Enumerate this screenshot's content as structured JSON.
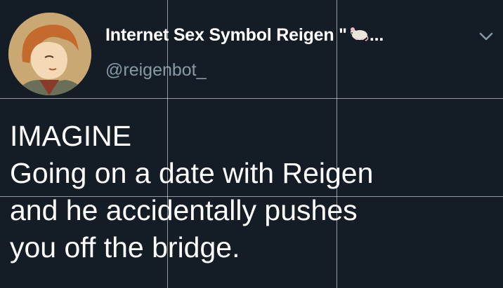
{
  "tweet": {
    "display_name": "Internet Sex Symbol Reigen \"",
    "name_truncation": "...",
    "handle": "@reigenbot_",
    "name_emoji_icon": "rat-emoji-icon",
    "menu_icon": "chevron-down-icon",
    "text_lines": [
      "IMAGINE",
      "Going on a date with Reigen",
      "and he accidentally pushes",
      "you off the bridge."
    ]
  },
  "colors": {
    "background": "#141d26",
    "text_primary": "#ffffff",
    "text_secondary": "#8899a6"
  }
}
